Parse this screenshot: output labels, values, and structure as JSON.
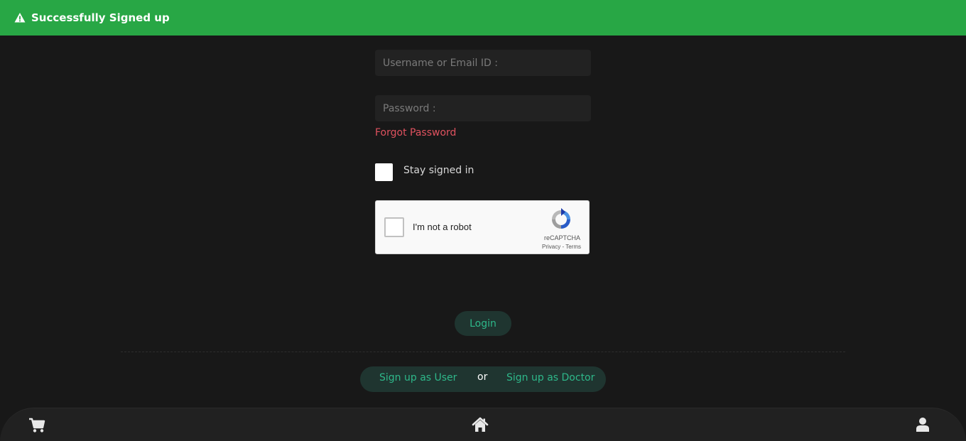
{
  "toast": {
    "message": "Successfully Signed up",
    "icon": "warning-icon",
    "color": "#28a745"
  },
  "form": {
    "username_placeholder": "Username or Email ID :",
    "username_value": "",
    "password_placeholder": "Password :",
    "password_value": "",
    "forgot_label": "Forgot Password",
    "stay_label": "Stay signed in",
    "stay_checked": false
  },
  "captcha": {
    "label": "I'm not a robot",
    "brand": "reCAPTCHA",
    "privacy": "Privacy",
    "separator": " - ",
    "terms": "Terms"
  },
  "login_label": "Login",
  "signup": {
    "user_label": "Sign up as User",
    "or_label": "or",
    "doctor_label": "Sign up as Doctor"
  },
  "nav": {
    "icons": [
      "cart-icon",
      "home-icon",
      "user-icon"
    ]
  },
  "colors": {
    "accent": "#2eb88a",
    "link_red": "#e0525f",
    "background": "#181818"
  }
}
